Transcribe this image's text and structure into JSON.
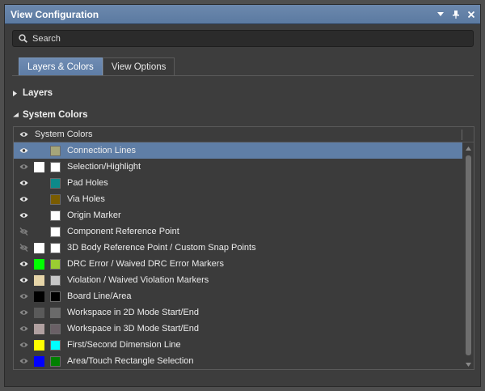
{
  "window": {
    "title": "View Configuration"
  },
  "search": {
    "placeholder": "Search"
  },
  "tabs": [
    {
      "label": "Layers & Colors",
      "active": true
    },
    {
      "label": "View Options",
      "active": false
    }
  ],
  "sections": {
    "layers": "Layers",
    "system_colors": "System Colors"
  },
  "grid": {
    "header": "System Colors",
    "rows": [
      {
        "label": "Connection Lines",
        "visible": true,
        "color1": null,
        "color2": "#a5a57a",
        "selected": true
      },
      {
        "label": "Selection/Highlight",
        "visible": false,
        "color1": "#ffffff",
        "color2": "#ffffff",
        "selected": false
      },
      {
        "label": "Pad Holes",
        "visible": true,
        "color1": null,
        "color2": "#0d8a8a",
        "selected": false
      },
      {
        "label": "Via Holes",
        "visible": true,
        "color1": null,
        "color2": "#7a5c00",
        "selected": false
      },
      {
        "label": "Origin Marker",
        "visible": true,
        "color1": null,
        "color2": "#ffffff",
        "selected": false
      },
      {
        "label": "Component Reference Point",
        "visible": "hidden",
        "color1": null,
        "color2": "#ffffff",
        "selected": false
      },
      {
        "label": "3D Body Reference Point / Custom Snap Points",
        "visible": "hidden",
        "color1": "#ffffff",
        "color2": "#ffffff",
        "selected": false
      },
      {
        "label": "DRC Error / Waived DRC Error Markers",
        "visible": true,
        "color1": "#00ff00",
        "color2": "#9acd32",
        "selected": false
      },
      {
        "label": "Violation / Waived Violation Markers",
        "visible": true,
        "color1": "#e6d5a8",
        "color2": "#c8c8c8",
        "selected": false
      },
      {
        "label": "Board Line/Area",
        "visible": false,
        "color1": "#000000",
        "color2": "#000000",
        "selected": false
      },
      {
        "label": "Workspace in 2D Mode Start/End",
        "visible": false,
        "color1": "#5a5a5a",
        "color2": "#6a6a6a",
        "selected": false
      },
      {
        "label": "Workspace in 3D Mode Start/End",
        "visible": false,
        "color1": "#b0a0a0",
        "color2": "#6a6066",
        "selected": false
      },
      {
        "label": "First/Second Dimension Line",
        "visible": false,
        "color1": "#ffff00",
        "color2": "#00ffff",
        "selected": false
      },
      {
        "label": "Area/Touch Rectangle Selection",
        "visible": false,
        "color1": "#0000ff",
        "color2": "#008000",
        "selected": false
      }
    ]
  },
  "colors": {
    "accent": "#5f7ea6",
    "panel_bg": "#3d3d3d"
  }
}
